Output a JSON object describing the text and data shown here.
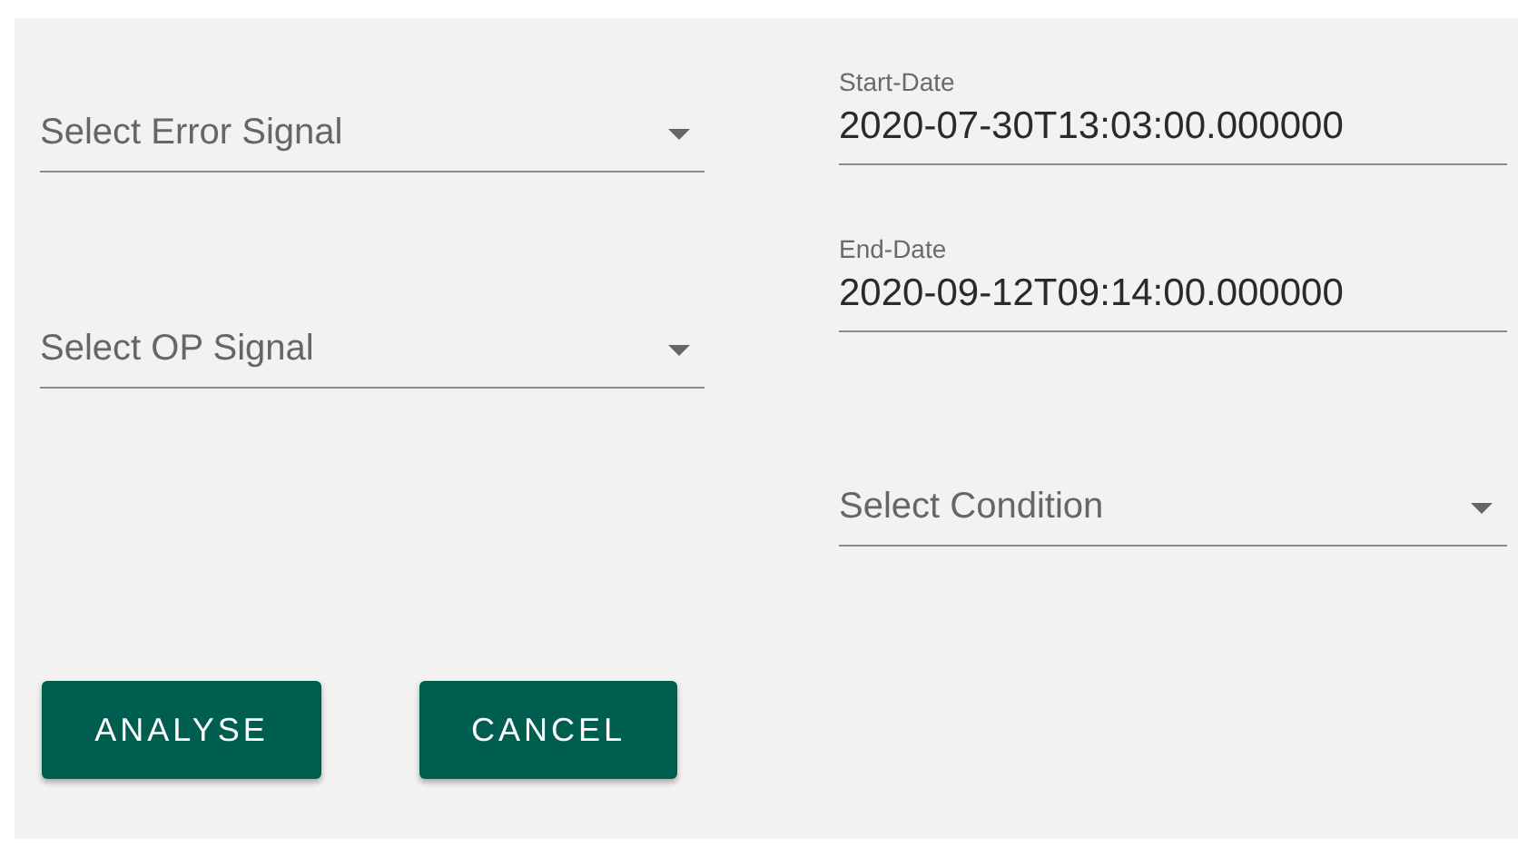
{
  "signal_selects": [
    {
      "placeholder": "Select Error Signal"
    },
    {
      "placeholder": "Select OP Signal"
    }
  ],
  "date_fields": [
    {
      "label": "Start-Date",
      "value": "2020-07-30T13:03:00.000000"
    },
    {
      "label": "End-Date",
      "value": "2020-09-12T09:14:00.000000"
    }
  ],
  "condition_select": {
    "placeholder": "Select Condition"
  },
  "buttons": [
    "ANALYSE",
    "CANCEL"
  ]
}
